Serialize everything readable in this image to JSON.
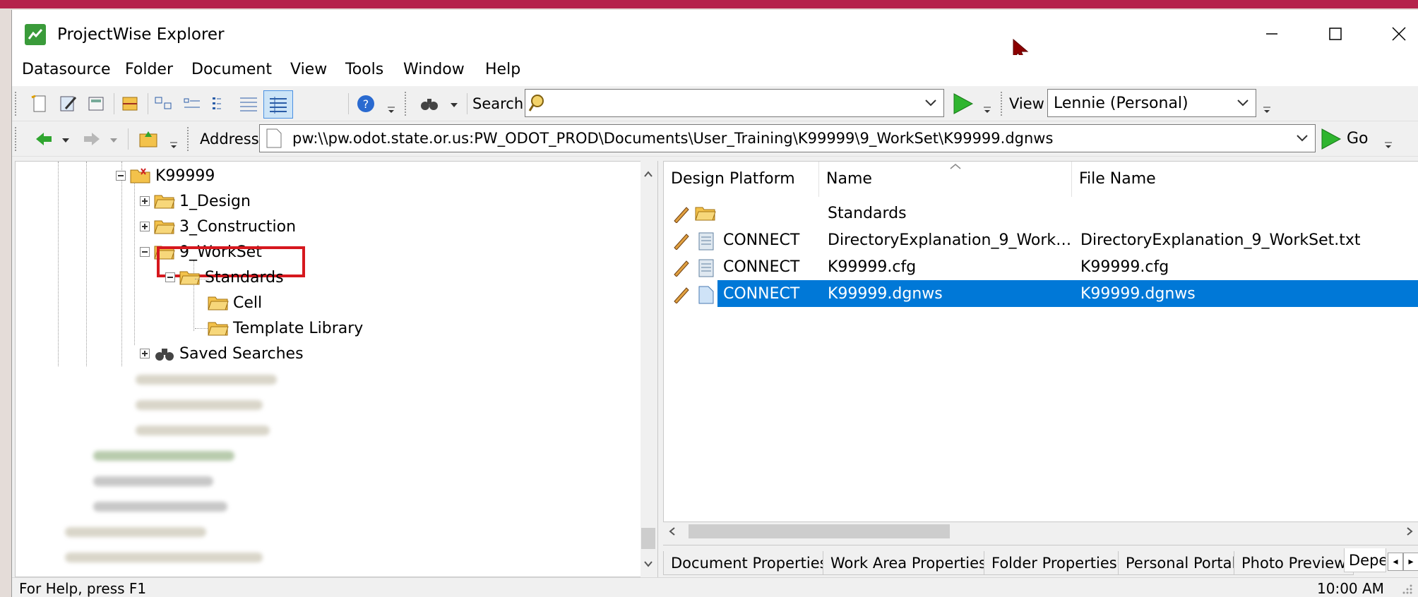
{
  "window": {
    "title": "ProjectWise Explorer",
    "accent_color": "#b5234b",
    "selection_color": "#0078d7"
  },
  "menu": [
    "Datasource",
    "Folder",
    "Document",
    "View",
    "Tools",
    "Window",
    "Help"
  ],
  "toolbar1": {
    "search_label": "Search",
    "search_value": "",
    "view_label": "View",
    "view_value": "Lennie (Personal)"
  },
  "toolbar2": {
    "address_label": "Address",
    "address_value": "pw:\\\\pw.odot.state.or.us:PW_ODOT_PROD\\Documents\\User_Training\\K99999\\9_WorkSet\\K99999.dgnws",
    "go_label": "Go"
  },
  "tree": {
    "root": "K99999",
    "design": "1_Design",
    "construction": "3_Construction",
    "workset": "9_WorkSet",
    "standards": "Standards",
    "cell": "Cell",
    "template_library": "Template Library",
    "saved_searches": "Saved Searches"
  },
  "list": {
    "headers": [
      "Design Platform",
      "Name",
      "File Name"
    ],
    "rows": [
      {
        "platform": "",
        "name": "Standards",
        "file": "",
        "icon": "folder-icon"
      },
      {
        "platform": "CONNECT",
        "name": "DirectoryExplanation_9_Work…",
        "file": "DirectoryExplanation_9_WorkSet.txt",
        "icon": "text-file-icon"
      },
      {
        "platform": "CONNECT",
        "name": "K99999.cfg",
        "file": "K99999.cfg",
        "icon": "text-file-icon"
      },
      {
        "platform": "CONNECT",
        "name": "K99999.dgnws",
        "file": "K99999.dgnws",
        "icon": "document-icon",
        "selected": true
      }
    ]
  },
  "tabs": [
    "Document Properties",
    "Work Area Properties",
    "Folder Properties",
    "Personal Portal",
    "Photo Preview",
    "Depe"
  ],
  "status": {
    "help": "For Help, press F1",
    "time": "10:00 AM"
  }
}
